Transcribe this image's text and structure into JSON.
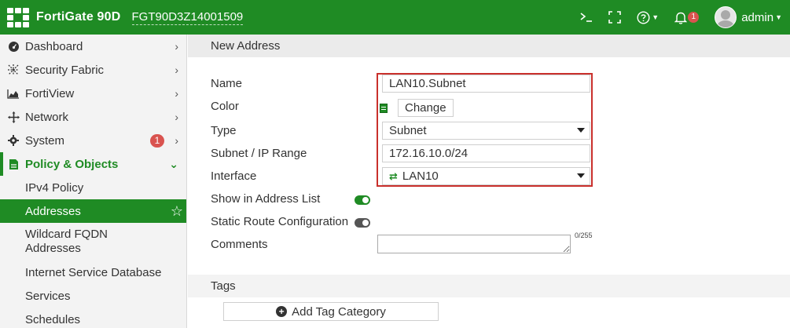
{
  "header": {
    "product": "FortiGate 90D",
    "serial": "FGT90D3Z14001509",
    "cli_icon": "terminal-icon",
    "fullscreen_icon": "fullscreen-icon",
    "help_icon": "help-icon",
    "alerts_icon": "bell-icon",
    "alerts_count": "1",
    "user_name": "admin",
    "brand_color": "#1f8b24"
  },
  "sidebar": {
    "items": [
      {
        "label": "Dashboard",
        "icon": "dashboard-icon"
      },
      {
        "label": "Security Fabric",
        "icon": "security-fabric-icon"
      },
      {
        "label": "FortiView",
        "icon": "fortiview-icon"
      },
      {
        "label": "Network",
        "icon": "network-icon"
      },
      {
        "label": "System",
        "icon": "gear-icon",
        "badge": "1"
      },
      {
        "label": "Policy & Objects",
        "icon": "policy-icon"
      }
    ],
    "subitems": [
      {
        "label": "IPv4 Policy"
      },
      {
        "label": "Addresses"
      },
      {
        "label": "Wildcard FQDN Addresses"
      },
      {
        "label": "Internet Service Database"
      },
      {
        "label": "Services"
      },
      {
        "label": "Schedules"
      }
    ]
  },
  "form": {
    "section_title": "New Address",
    "name_label": "Name",
    "name_value": "LAN10.Subnet",
    "color_label": "Color",
    "change_button": "Change",
    "type_label": "Type",
    "type_value": "Subnet",
    "subnet_label": "Subnet / IP Range",
    "subnet_value": "172.16.10.0/24",
    "interface_label": "Interface",
    "interface_value": "LAN10",
    "show_in_list_label": "Show in Address List",
    "show_in_list_enabled": true,
    "static_route_label": "Static Route Configuration",
    "static_route_enabled": false,
    "comments_label": "Comments",
    "comments_counter": "0/255",
    "tags_title": "Tags",
    "add_tag_button": "Add Tag Category",
    "highlight_color": "#c9302c"
  }
}
